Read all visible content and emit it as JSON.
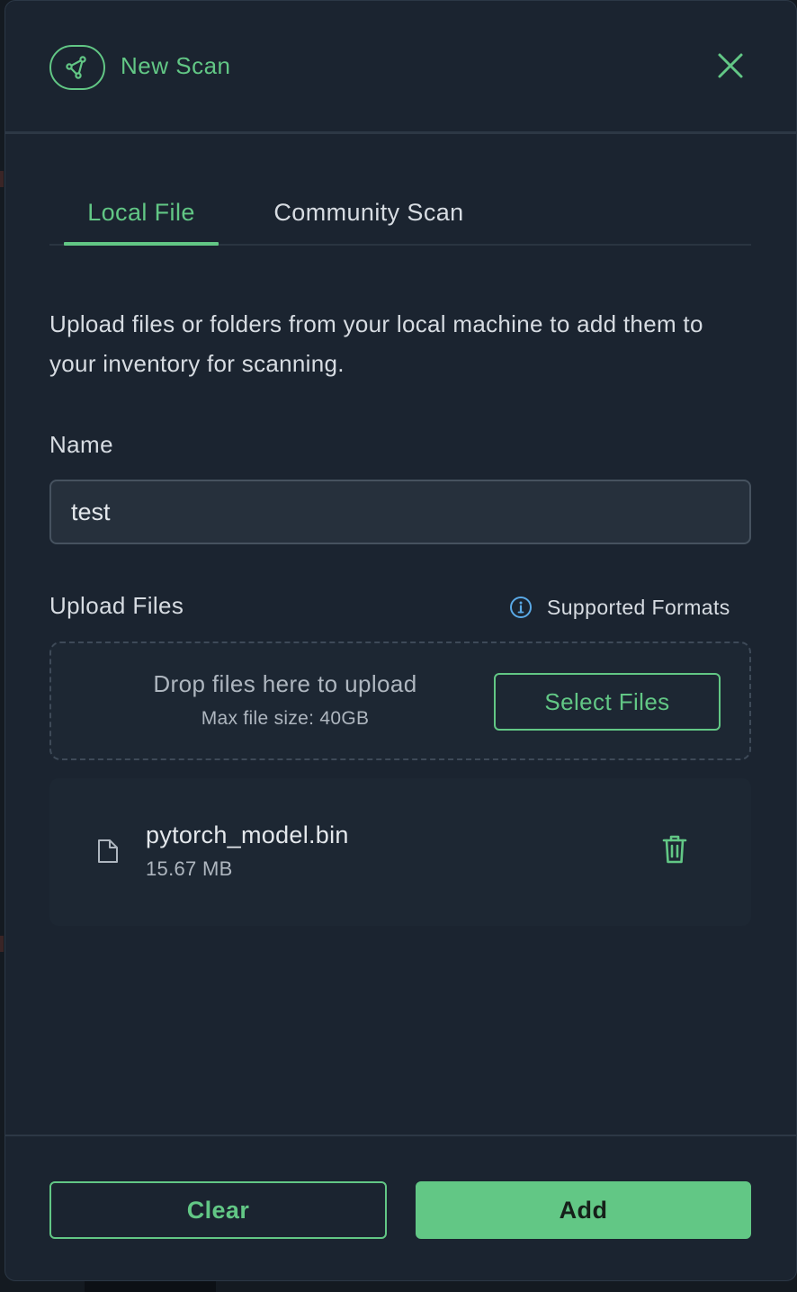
{
  "header": {
    "title": "New Scan",
    "icon": "scan-network-icon",
    "close_icon": "close-icon"
  },
  "tabs": [
    {
      "label": "Local File",
      "active": true
    },
    {
      "label": "Community Scan",
      "active": false
    }
  ],
  "description": "Upload files or folders from your local machine to add them to your inventory for scanning.",
  "name_field": {
    "label": "Name",
    "value": "test"
  },
  "upload": {
    "label": "Upload Files",
    "supported_formats": "Supported Formats",
    "drop_text": "Drop files here to upload",
    "max_size": "Max file size: 40GB",
    "select_button": "Select Files"
  },
  "files": [
    {
      "name": "pytorch_model.bin",
      "size": "15.67 MB"
    }
  ],
  "footer": {
    "clear_label": "Clear",
    "add_label": "Add"
  },
  "colors": {
    "accent": "#62c785",
    "panel_bg": "#1b2430",
    "input_bg": "#26303c",
    "text": "#d7dce2",
    "info": "#5aa9e6"
  }
}
